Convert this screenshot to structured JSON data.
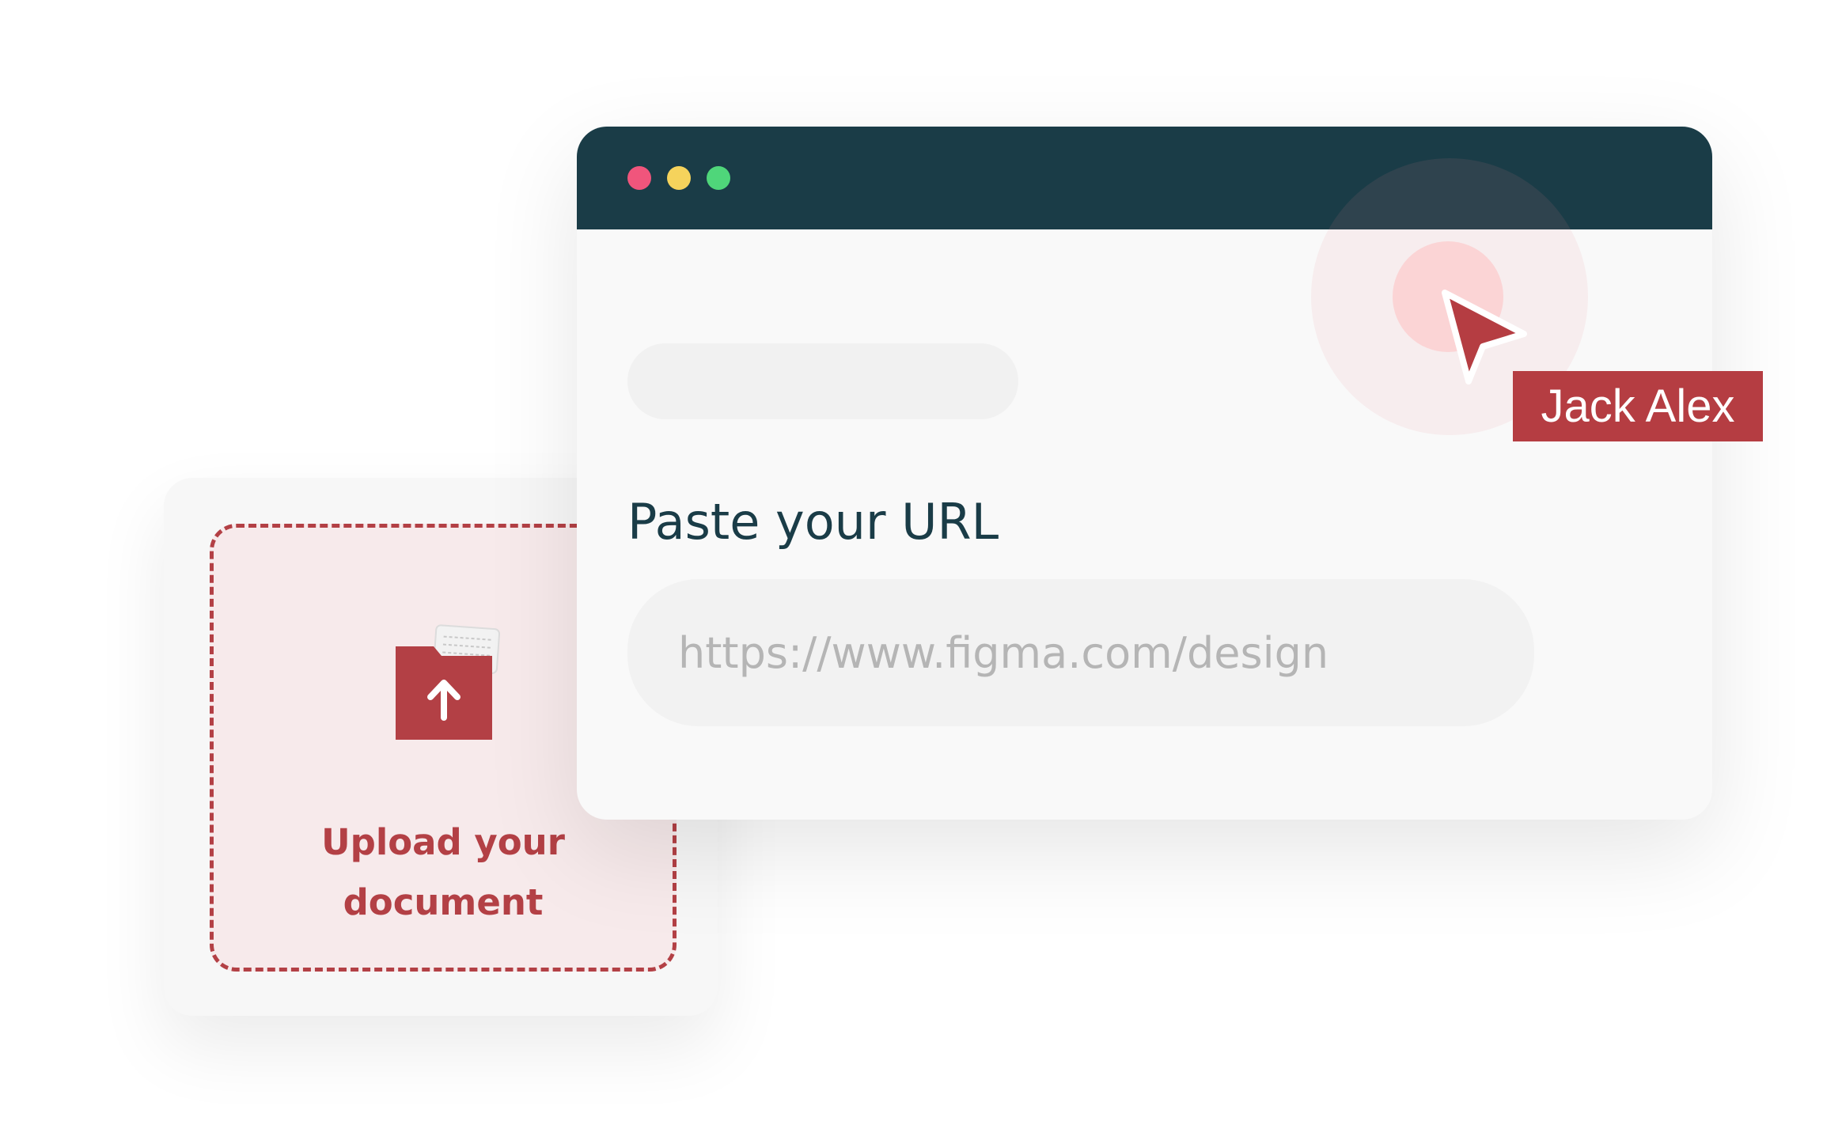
{
  "upload": {
    "label_line1": "Upload your",
    "label_line2": "document",
    "icon": "folder-upload-icon",
    "accent_color": "#b34045"
  },
  "browser": {
    "titlebar_color": "#1a3c47",
    "window_controls": [
      "close-dot",
      "minimize-dot",
      "maximize-dot"
    ],
    "heading": "Paste your URL",
    "url_input": {
      "value": "",
      "placeholder": "https://www.figma.com/design"
    }
  },
  "collaborator": {
    "name": "Jack Alex",
    "tag_color": "#b53d42",
    "icon": "cursor-arrow-icon"
  }
}
